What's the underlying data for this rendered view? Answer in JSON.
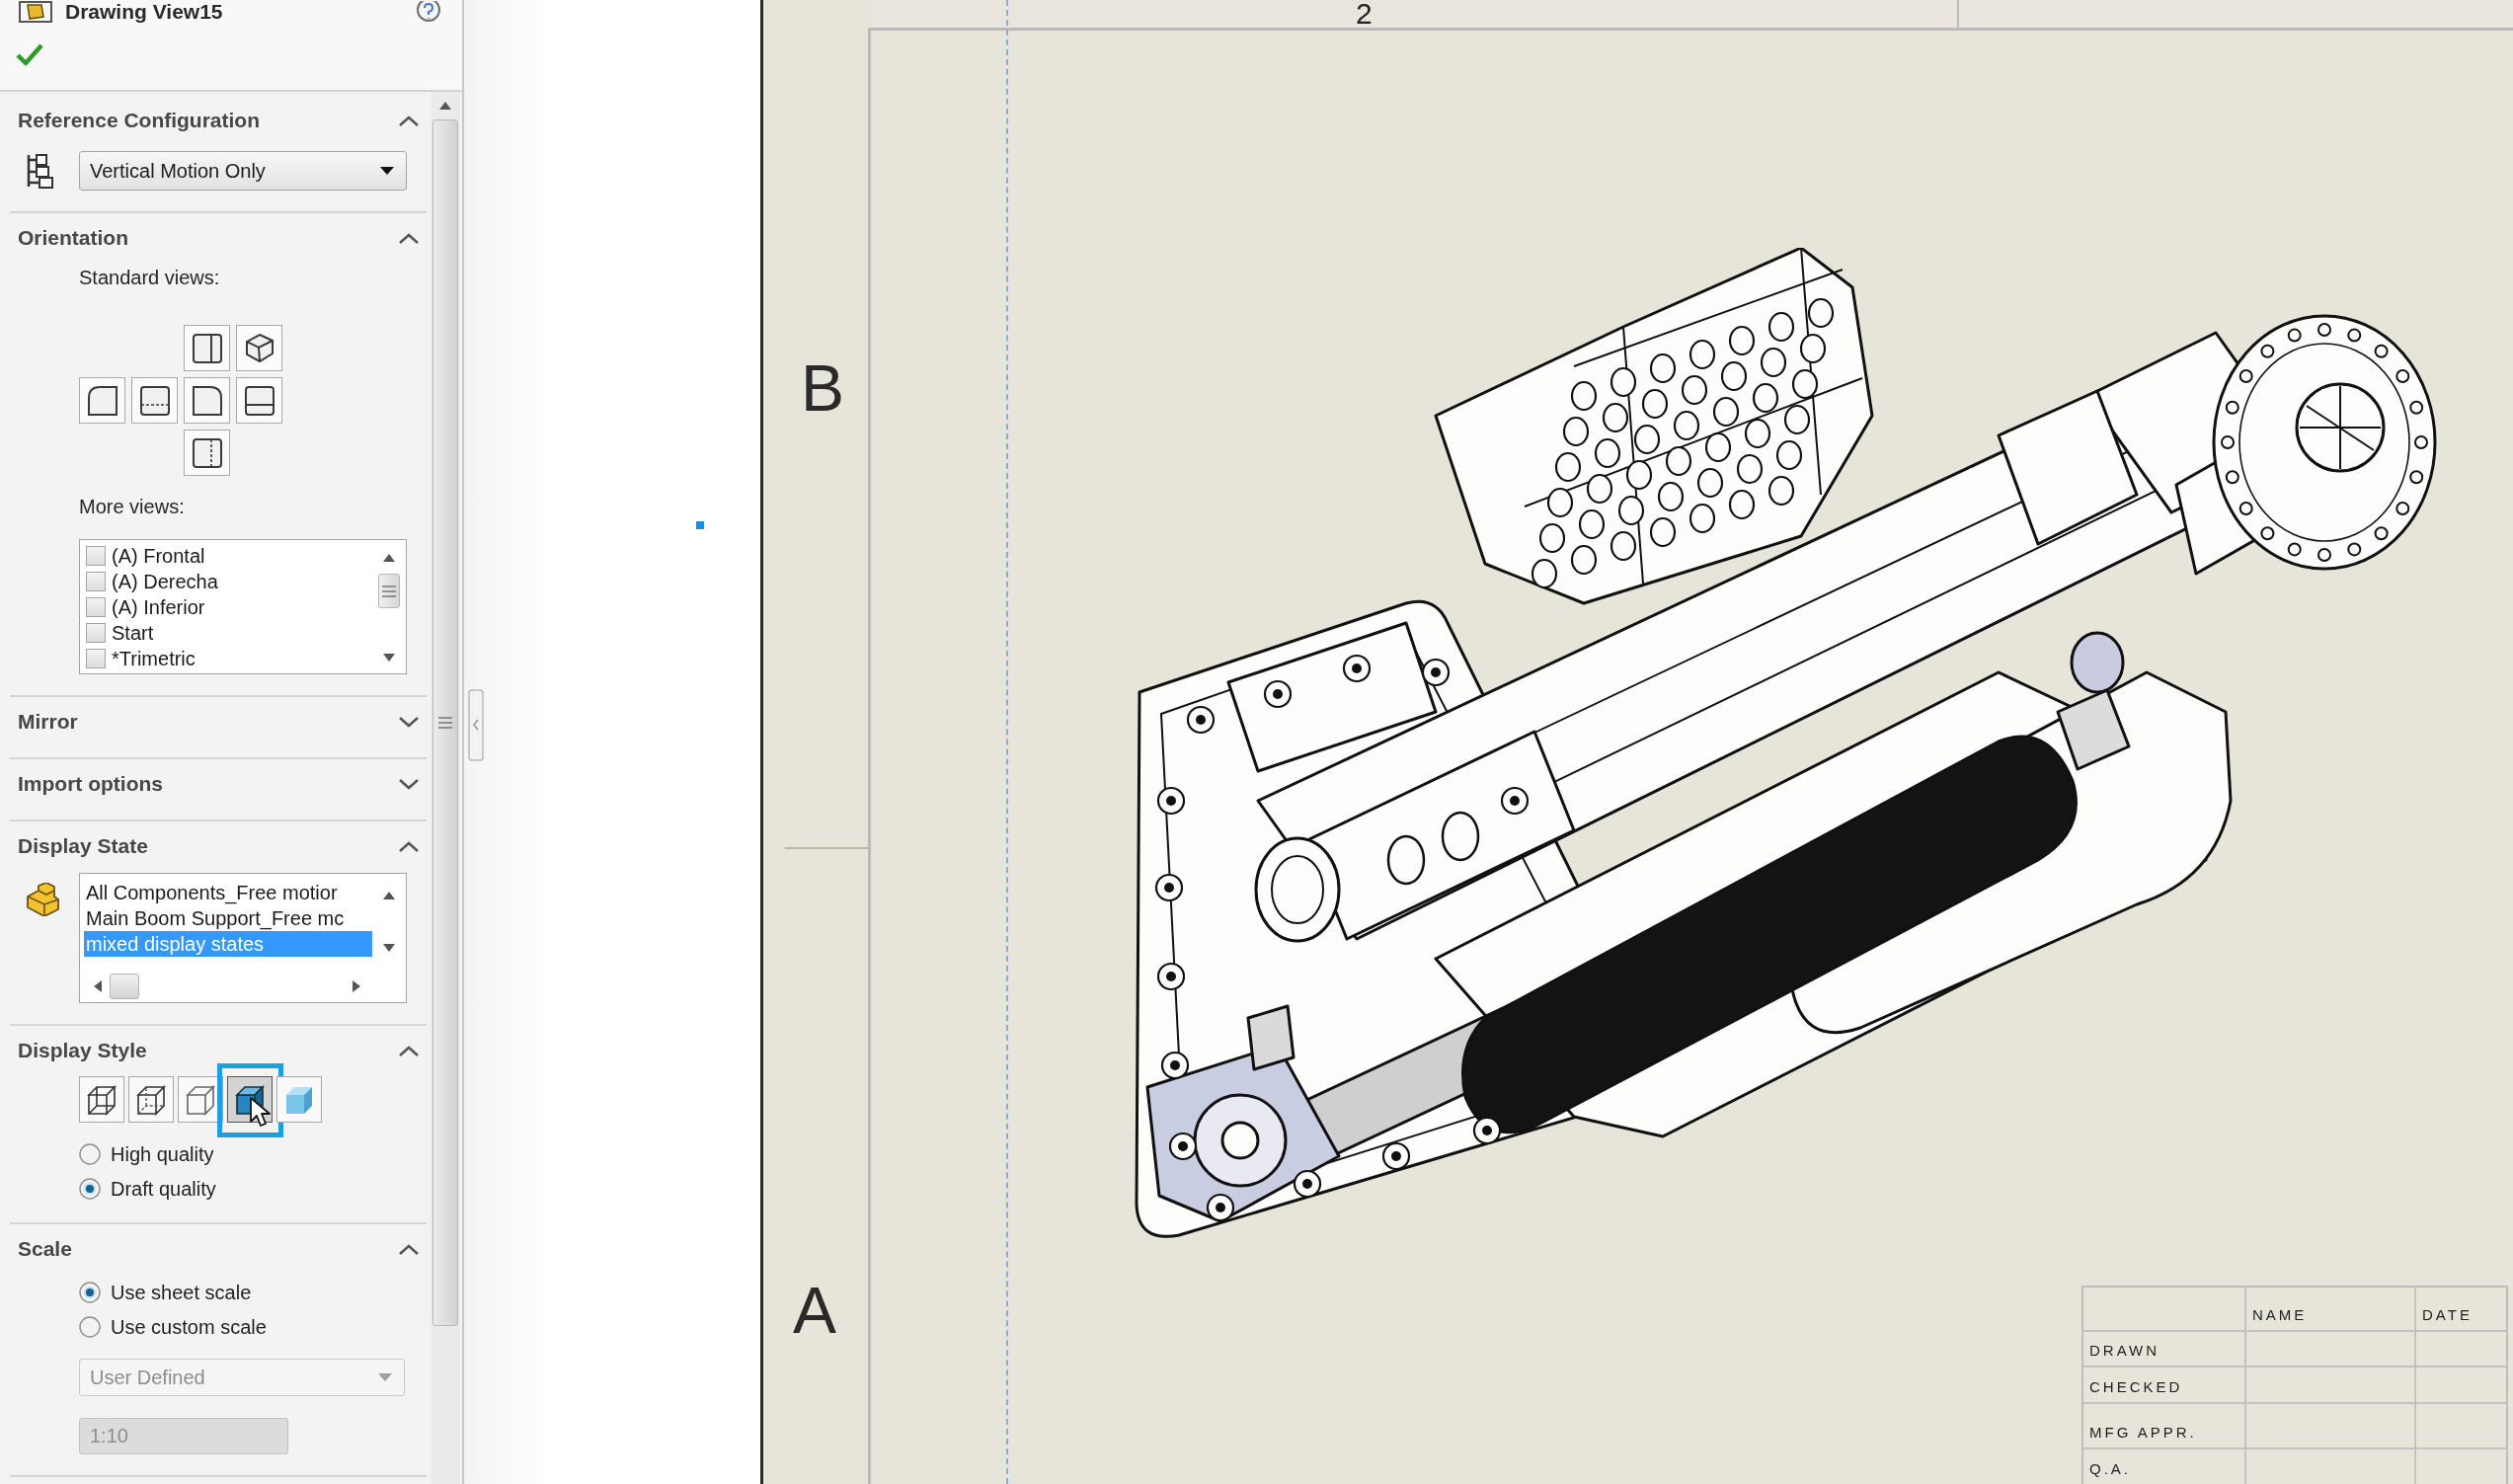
{
  "panel": {
    "title": "Drawing View15"
  },
  "sections": [
    {
      "kind": "configuration",
      "title": "Reference Configuration",
      "expanded": true,
      "dropdown": {
        "value": "Vertical Motion Only"
      }
    },
    {
      "kind": "orientation",
      "title": "Orientation",
      "expanded": true,
      "standard_views_label": "Standard views:",
      "more_views_label": "More views:",
      "more_views": [
        {
          "label": "(A) Frontal",
          "checked": false
        },
        {
          "label": "(A) Derecha",
          "checked": false
        },
        {
          "label": "(A) Inferior",
          "checked": false
        },
        {
          "label": "Start",
          "checked": false
        },
        {
          "label": "*Trimetric",
          "checked": false
        }
      ]
    },
    {
      "title": "Mirror",
      "expanded": false
    },
    {
      "title": "Import options",
      "expanded": false
    },
    {
      "kind": "display_state",
      "title": "Display State",
      "expanded": true,
      "states": [
        {
          "label": "All Components_Free motior",
          "selected": false
        },
        {
          "label": "Main Boom Support_Free mc",
          "selected": false
        },
        {
          "label": "mixed display states",
          "selected": true
        }
      ]
    },
    {
      "kind": "display_style",
      "title": "Display Style",
      "expanded": true,
      "styles": [
        {
          "selected": false
        },
        {
          "selected": false
        },
        {
          "selected": false
        },
        {
          "selected": true
        },
        {
          "selected": false
        }
      ],
      "quality": [
        {
          "label": "High quality",
          "selected": false
        },
        {
          "label": "Draft quality",
          "selected": true
        }
      ]
    },
    {
      "kind": "scale",
      "title": "Scale",
      "expanded": true,
      "options": [
        {
          "label": "Use sheet scale",
          "selected": true
        },
        {
          "label": "Use custom scale",
          "selected": false
        }
      ],
      "preset": {
        "value": "User Defined",
        "disabled": true
      },
      "custom": {
        "value": "1:10",
        "disabled": true
      }
    }
  ],
  "sheet": {
    "top_zone": "2",
    "left_zones": [
      "B",
      "A"
    ],
    "title_block": {
      "columns": [
        "NAME",
        "DATE"
      ],
      "rows": [
        "DRAWN",
        "CHECKED",
        "MFG APPR.",
        "Q.A."
      ]
    }
  }
}
